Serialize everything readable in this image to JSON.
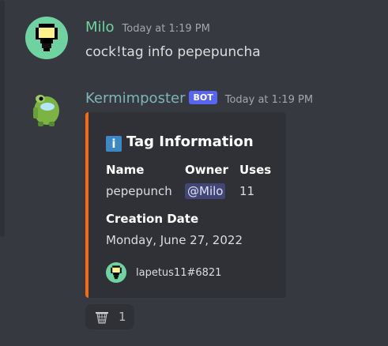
{
  "colors": {
    "background": "#36393f",
    "embed_accent": "#f46b17",
    "bot_tag": "#5865f2"
  },
  "message1": {
    "author": "Milo",
    "author_color": "#6fd3a1",
    "timestamp": "Today at 1:19 PM",
    "content": "cock!tag info pepepuncha"
  },
  "message2": {
    "author": "Kermimposter",
    "author_color": "#7fb4b9",
    "bot_tag": "BOT",
    "timestamp": "Today at 1:19 PM",
    "embed": {
      "icon": "i",
      "title": "Tag Information",
      "fields": {
        "name_label": "Name",
        "name_value": "pepepunch",
        "owner_label": "Owner",
        "owner_value": "@Milo",
        "uses_label": "Uses",
        "uses_value": "11",
        "creation_label": "Creation Date",
        "creation_value": "Monday, June 27, 2022"
      },
      "footer": "lapetus11#6821"
    },
    "reaction": {
      "emoji": "basket-icon",
      "count": "1"
    }
  }
}
